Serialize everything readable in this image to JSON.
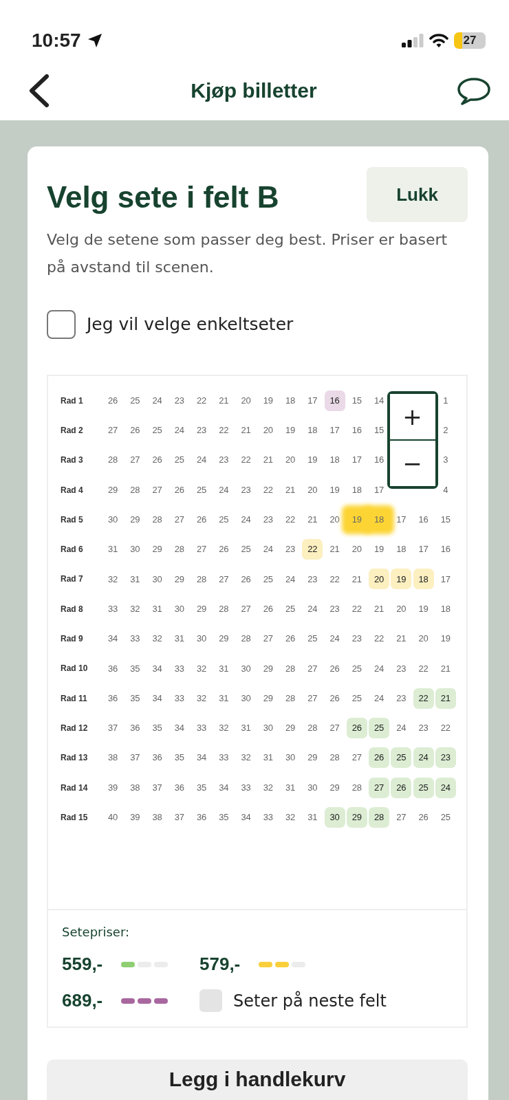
{
  "status_bar": {
    "time": "10:57",
    "battery": "27"
  },
  "nav": {
    "title": "Kjøp billetter"
  },
  "panel": {
    "title": "Velg sete i felt B",
    "close_button": "Lukk",
    "description": "Velg de setene som passer deg best. Priser er basert på avstand til scenen.",
    "single_seats": {
      "label": "Jeg vil velge enkeltseter",
      "checked": false
    }
  },
  "zoom": {
    "plus": "+",
    "minus": "−"
  },
  "rows": [
    {
      "label": "Rad 1",
      "seats": [
        {
          "n": "26",
          "selected": false
        },
        {
          "n": "25",
          "selected": false
        },
        {
          "n": "24",
          "selected": false
        },
        {
          "n": "23",
          "selected": false
        },
        {
          "n": "22",
          "selected": false
        },
        {
          "n": "21",
          "selected": false
        },
        {
          "n": "20",
          "selected": false
        },
        {
          "n": "19",
          "selected": false
        },
        {
          "n": "18",
          "selected": false
        },
        {
          "n": "17",
          "selected": false
        },
        {
          "n": "16",
          "selected": false,
          "color": "#ead9e6"
        },
        {
          "n": "15",
          "selected": false
        },
        {
          "n": "14",
          "selected": false
        },
        {
          "n": "1",
          "selected": false
        }
      ]
    },
    {
      "label": "Rad 2",
      "seats": [
        {
          "n": "27",
          "selected": false
        },
        {
          "n": "26",
          "selected": false
        },
        {
          "n": "25",
          "selected": false
        },
        {
          "n": "24",
          "selected": false
        },
        {
          "n": "23",
          "selected": false
        },
        {
          "n": "22",
          "selected": false
        },
        {
          "n": "21",
          "selected": false
        },
        {
          "n": "20",
          "selected": false
        },
        {
          "n": "19",
          "selected": false
        },
        {
          "n": "18",
          "selected": false
        },
        {
          "n": "17",
          "selected": false
        },
        {
          "n": "16",
          "selected": false
        },
        {
          "n": "15",
          "selected": false
        },
        {
          "n": "2",
          "selected": false
        }
      ]
    },
    {
      "label": "Rad 3",
      "seats": [
        {
          "n": "28",
          "selected": false
        },
        {
          "n": "27",
          "selected": false
        },
        {
          "n": "26",
          "selected": false
        },
        {
          "n": "25",
          "selected": false
        },
        {
          "n": "24",
          "selected": false
        },
        {
          "n": "23",
          "selected": false
        },
        {
          "n": "22",
          "selected": false
        },
        {
          "n": "21",
          "selected": false
        },
        {
          "n": "20",
          "selected": false
        },
        {
          "n": "19",
          "selected": false
        },
        {
          "n": "18",
          "selected": false
        },
        {
          "n": "17",
          "selected": false
        },
        {
          "n": "16",
          "selected": false
        },
        {
          "n": "3",
          "selected": false
        }
      ]
    },
    {
      "label": "Rad 4",
      "seats": [
        {
          "n": "29",
          "selected": false
        },
        {
          "n": "28",
          "selected": false
        },
        {
          "n": "27",
          "selected": false
        },
        {
          "n": "26",
          "selected": false
        },
        {
          "n": "25",
          "selected": false
        },
        {
          "n": "24",
          "selected": false
        },
        {
          "n": "23",
          "selected": false
        },
        {
          "n": "22",
          "selected": false
        },
        {
          "n": "21",
          "selected": false
        },
        {
          "n": "20",
          "selected": false
        },
        {
          "n": "19",
          "selected": false
        },
        {
          "n": "18",
          "selected": false
        },
        {
          "n": "17",
          "selected": false
        },
        {
          "n": "4",
          "selected": false
        }
      ]
    },
    {
      "label": "Rad 5",
      "seats": [
        {
          "n": "30",
          "selected": false
        },
        {
          "n": "29",
          "selected": false
        },
        {
          "n": "28",
          "selected": false
        },
        {
          "n": "27",
          "selected": false
        },
        {
          "n": "26",
          "selected": false
        },
        {
          "n": "25",
          "selected": false
        },
        {
          "n": "24",
          "selected": false
        },
        {
          "n": "23",
          "selected": false
        },
        {
          "n": "22",
          "selected": false
        },
        {
          "n": "21",
          "selected": false
        },
        {
          "n": "20",
          "selected": false
        },
        {
          "n": "19",
          "selected": true
        },
        {
          "n": "18",
          "selected": true
        },
        {
          "n": "17",
          "selected": false
        },
        {
          "n": "16",
          "selected": false
        },
        {
          "n": "15",
          "selected": false
        }
      ]
    },
    {
      "label": "Rad 6",
      "seats": [
        {
          "n": "31",
          "selected": false
        },
        {
          "n": "30",
          "selected": false
        },
        {
          "n": "29",
          "selected": false
        },
        {
          "n": "28",
          "selected": false
        },
        {
          "n": "27",
          "selected": false
        },
        {
          "n": "26",
          "selected": false
        },
        {
          "n": "25",
          "selected": false
        },
        {
          "n": "24",
          "selected": false
        },
        {
          "n": "23",
          "selected": false
        },
        {
          "n": "22",
          "selected": false,
          "color": "#fcefc0"
        },
        {
          "n": "21",
          "selected": false
        },
        {
          "n": "20",
          "selected": false
        },
        {
          "n": "19",
          "selected": false
        },
        {
          "n": "18",
          "selected": false
        },
        {
          "n": "17",
          "selected": false
        },
        {
          "n": "16",
          "selected": false
        }
      ]
    },
    {
      "label": "Rad 7",
      "seats": [
        {
          "n": "32",
          "selected": false
        },
        {
          "n": "31",
          "selected": false
        },
        {
          "n": "30",
          "selected": false
        },
        {
          "n": "29",
          "selected": false
        },
        {
          "n": "28",
          "selected": false
        },
        {
          "n": "27",
          "selected": false
        },
        {
          "n": "26",
          "selected": false
        },
        {
          "n": "25",
          "selected": false
        },
        {
          "n": "24",
          "selected": false
        },
        {
          "n": "23",
          "selected": false
        },
        {
          "n": "22",
          "selected": false
        },
        {
          "n": "21",
          "selected": false
        },
        {
          "n": "20",
          "selected": false,
          "color": "#fcefc0"
        },
        {
          "n": "19",
          "selected": false,
          "color": "#fcefc0"
        },
        {
          "n": "18",
          "selected": false,
          "color": "#fcefc0"
        },
        {
          "n": "17",
          "selected": false
        }
      ]
    },
    {
      "label": "Rad 8",
      "seats": [
        {
          "n": "33",
          "selected": false
        },
        {
          "n": "32",
          "selected": false
        },
        {
          "n": "31",
          "selected": false
        },
        {
          "n": "30",
          "selected": false
        },
        {
          "n": "29",
          "selected": false
        },
        {
          "n": "28",
          "selected": false
        },
        {
          "n": "27",
          "selected": false
        },
        {
          "n": "26",
          "selected": false
        },
        {
          "n": "25",
          "selected": false
        },
        {
          "n": "24",
          "selected": false
        },
        {
          "n": "23",
          "selected": false
        },
        {
          "n": "22",
          "selected": false
        },
        {
          "n": "21",
          "selected": false
        },
        {
          "n": "20",
          "selected": false
        },
        {
          "n": "19",
          "selected": false
        },
        {
          "n": "18",
          "selected": false
        }
      ]
    },
    {
      "label": "Rad 9",
      "seats": [
        {
          "n": "34",
          "selected": false
        },
        {
          "n": "33",
          "selected": false
        },
        {
          "n": "32",
          "selected": false
        },
        {
          "n": "31",
          "selected": false
        },
        {
          "n": "30",
          "selected": false
        },
        {
          "n": "29",
          "selected": false
        },
        {
          "n": "28",
          "selected": false
        },
        {
          "n": "27",
          "selected": false
        },
        {
          "n": "26",
          "selected": false
        },
        {
          "n": "25",
          "selected": false
        },
        {
          "n": "24",
          "selected": false
        },
        {
          "n": "23",
          "selected": false
        },
        {
          "n": "22",
          "selected": false
        },
        {
          "n": "21",
          "selected": false
        },
        {
          "n": "20",
          "selected": false
        },
        {
          "n": "19",
          "selected": false
        }
      ]
    },
    {
      "label": "Rad 10",
      "seats": [
        {
          "n": "36",
          "selected": false
        },
        {
          "n": "35",
          "selected": false
        },
        {
          "n": "34",
          "selected": false
        },
        {
          "n": "33",
          "selected": false
        },
        {
          "n": "32",
          "selected": false
        },
        {
          "n": "31",
          "selected": false
        },
        {
          "n": "30",
          "selected": false
        },
        {
          "n": "29",
          "selected": false
        },
        {
          "n": "28",
          "selected": false
        },
        {
          "n": "27",
          "selected": false
        },
        {
          "n": "26",
          "selected": false
        },
        {
          "n": "25",
          "selected": false
        },
        {
          "n": "24",
          "selected": false
        },
        {
          "n": "23",
          "selected": false
        },
        {
          "n": "22",
          "selected": false
        },
        {
          "n": "21",
          "selected": false
        }
      ]
    },
    {
      "label": "Rad 11",
      "seats": [
        {
          "n": "36",
          "selected": false
        },
        {
          "n": "35",
          "selected": false
        },
        {
          "n": "34",
          "selected": false
        },
        {
          "n": "33",
          "selected": false
        },
        {
          "n": "32",
          "selected": false
        },
        {
          "n": "31",
          "selected": false
        },
        {
          "n": "30",
          "selected": false
        },
        {
          "n": "29",
          "selected": false
        },
        {
          "n": "28",
          "selected": false
        },
        {
          "n": "27",
          "selected": false
        },
        {
          "n": "26",
          "selected": false
        },
        {
          "n": "25",
          "selected": false
        },
        {
          "n": "24",
          "selected": false
        },
        {
          "n": "23",
          "selected": false
        },
        {
          "n": "22",
          "selected": false,
          "color": "#dcedd3"
        },
        {
          "n": "21",
          "selected": false,
          "color": "#dcedd3"
        }
      ]
    },
    {
      "label": "Rad 12",
      "seats": [
        {
          "n": "37",
          "selected": false
        },
        {
          "n": "36",
          "selected": false
        },
        {
          "n": "35",
          "selected": false
        },
        {
          "n": "34",
          "selected": false
        },
        {
          "n": "33",
          "selected": false
        },
        {
          "n": "32",
          "selected": false
        },
        {
          "n": "31",
          "selected": false
        },
        {
          "n": "30",
          "selected": false
        },
        {
          "n": "29",
          "selected": false
        },
        {
          "n": "28",
          "selected": false
        },
        {
          "n": "27",
          "selected": false
        },
        {
          "n": "26",
          "selected": false,
          "color": "#dcedd3"
        },
        {
          "n": "25",
          "selected": false,
          "color": "#dcedd3"
        },
        {
          "n": "24",
          "selected": false
        },
        {
          "n": "23",
          "selected": false
        },
        {
          "n": "22",
          "selected": false
        }
      ]
    },
    {
      "label": "Rad 13",
      "seats": [
        {
          "n": "38",
          "selected": false
        },
        {
          "n": "37",
          "selected": false
        },
        {
          "n": "36",
          "selected": false
        },
        {
          "n": "35",
          "selected": false
        },
        {
          "n": "34",
          "selected": false
        },
        {
          "n": "33",
          "selected": false
        },
        {
          "n": "32",
          "selected": false
        },
        {
          "n": "31",
          "selected": false
        },
        {
          "n": "30",
          "selected": false
        },
        {
          "n": "29",
          "selected": false
        },
        {
          "n": "28",
          "selected": false
        },
        {
          "n": "27",
          "selected": false
        },
        {
          "n": "26",
          "selected": false,
          "color": "#dcedd3"
        },
        {
          "n": "25",
          "selected": false,
          "color": "#dcedd3"
        },
        {
          "n": "24",
          "selected": false,
          "color": "#dcedd3"
        },
        {
          "n": "23",
          "selected": false,
          "color": "#dcedd3"
        }
      ]
    },
    {
      "label": "Rad 14",
      "seats": [
        {
          "n": "39",
          "selected": false
        },
        {
          "n": "38",
          "selected": false
        },
        {
          "n": "37",
          "selected": false
        },
        {
          "n": "36",
          "selected": false
        },
        {
          "n": "35",
          "selected": false
        },
        {
          "n": "34",
          "selected": false
        },
        {
          "n": "33",
          "selected": false
        },
        {
          "n": "32",
          "selected": false
        },
        {
          "n": "31",
          "selected": false
        },
        {
          "n": "30",
          "selected": false
        },
        {
          "n": "29",
          "selected": false
        },
        {
          "n": "28",
          "selected": false
        },
        {
          "n": "27",
          "selected": false,
          "color": "#dcedd3"
        },
        {
          "n": "26",
          "selected": false,
          "color": "#dcedd3"
        },
        {
          "n": "25",
          "selected": false,
          "color": "#dcedd3"
        },
        {
          "n": "24",
          "selected": false,
          "color": "#dcedd3"
        }
      ]
    },
    {
      "label": "Rad 15",
      "seats": [
        {
          "n": "40",
          "selected": false
        },
        {
          "n": "39",
          "selected": false
        },
        {
          "n": "38",
          "selected": false
        },
        {
          "n": "37",
          "selected": false
        },
        {
          "n": "36",
          "selected": false
        },
        {
          "n": "35",
          "selected": false
        },
        {
          "n": "34",
          "selected": false
        },
        {
          "n": "33",
          "selected": false
        },
        {
          "n": "32",
          "selected": false
        },
        {
          "n": "31",
          "selected": false
        },
        {
          "n": "30",
          "selected": false,
          "color": "#dcedd3"
        },
        {
          "n": "29",
          "selected": false,
          "color": "#dcedd3"
        },
        {
          "n": "28",
          "selected": false,
          "color": "#dcedd3"
        },
        {
          "n": "27",
          "selected": false
        },
        {
          "n": "26",
          "selected": false
        },
        {
          "n": "25",
          "selected": false
        }
      ]
    }
  ],
  "legend": {
    "title": "Setepriser:",
    "items": [
      {
        "kind": "price",
        "label": "559,-",
        "dashes": [
          {
            "color": "#8fce72"
          },
          {
            "color": "#ececec"
          },
          {
            "color": "#ececec"
          }
        ]
      },
      {
        "kind": "price",
        "label": "579,-",
        "dashes": [
          {
            "color": "#f9cf3c"
          },
          {
            "color": "#f9cf3c"
          },
          {
            "color": "#ececec"
          }
        ]
      },
      {
        "kind": "price",
        "label": "689,-",
        "dashes": [
          {
            "color": "#a8689f"
          },
          {
            "color": "#a8689f"
          },
          {
            "color": "#a8689f"
          }
        ]
      },
      {
        "kind": "swatch",
        "label": "Seter på neste felt",
        "color": "#e4e4e4"
      }
    ]
  },
  "add_button": "Legg i handlekurv"
}
